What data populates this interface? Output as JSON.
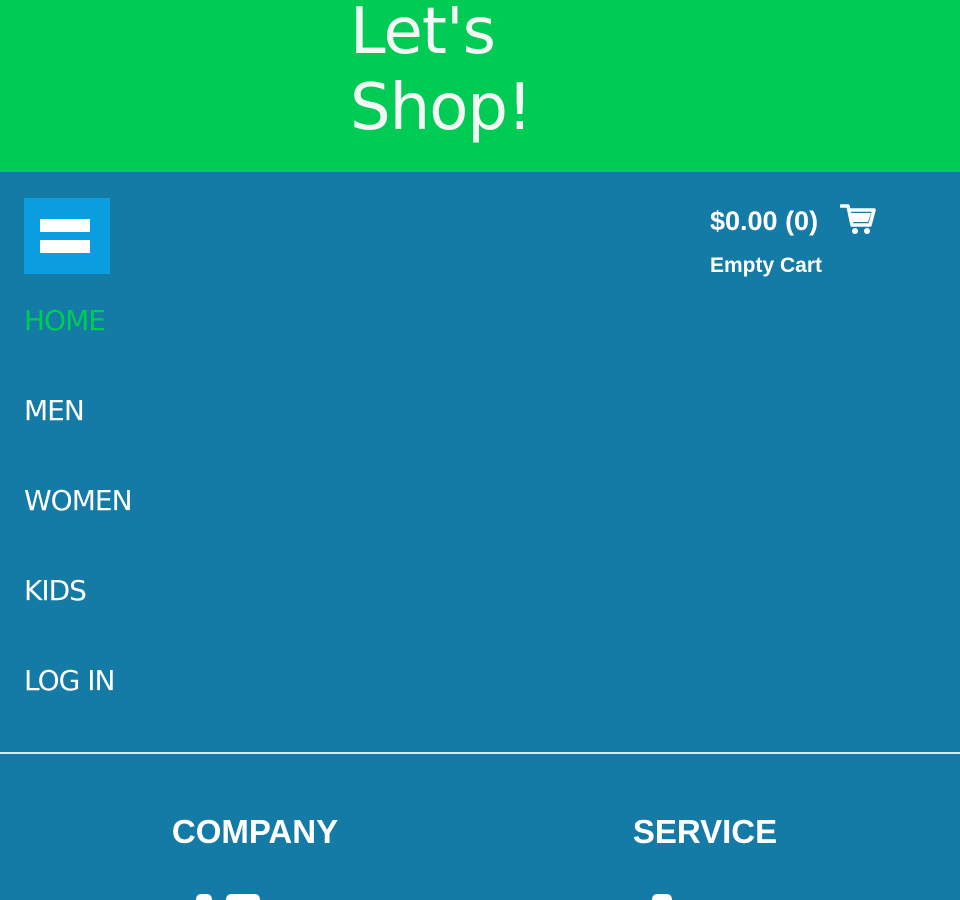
{
  "header": {
    "site_title": "Let's Shop!",
    "background_color": "#00cc55"
  },
  "menu": {
    "toggle_icon": "hamburger-menu-icon",
    "items": [
      {
        "label": "HOME",
        "active": true
      },
      {
        "label": "MEN",
        "active": false
      },
      {
        "label": "WOMEN",
        "active": false
      },
      {
        "label": "KIDS",
        "active": false
      },
      {
        "label": "LOG IN",
        "active": false
      }
    ],
    "active_color": "#00cc55"
  },
  "cart": {
    "total": "$0.00 (0)",
    "status": "Empty Cart",
    "icon": "shopping-cart-icon"
  },
  "footer": {
    "company_heading": "COMPANY",
    "service_heading": "SERVICE"
  },
  "theme": {
    "page_background": "#137ba5",
    "toggle_background": "#0a9ee0"
  }
}
